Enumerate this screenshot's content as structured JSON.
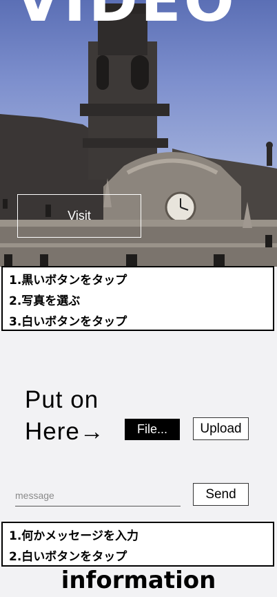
{
  "hero": {
    "title": "VIDEO",
    "visit_label": "Visit"
  },
  "instructions_1": [
    "1.黒いボタンをタップ",
    "2.写真を選ぶ",
    "3.白いボタンをタップ"
  ],
  "upload": {
    "prompt_line1": "Put on",
    "prompt_line2": "Here→",
    "file_label": "File...",
    "upload_label": "Upload"
  },
  "message": {
    "placeholder": "message",
    "value": "",
    "send_label": "Send"
  },
  "instructions_2": [
    "1.何かメッセージを入力",
    "2.白いボタンをタップ"
  ],
  "info": {
    "heading": "information"
  }
}
